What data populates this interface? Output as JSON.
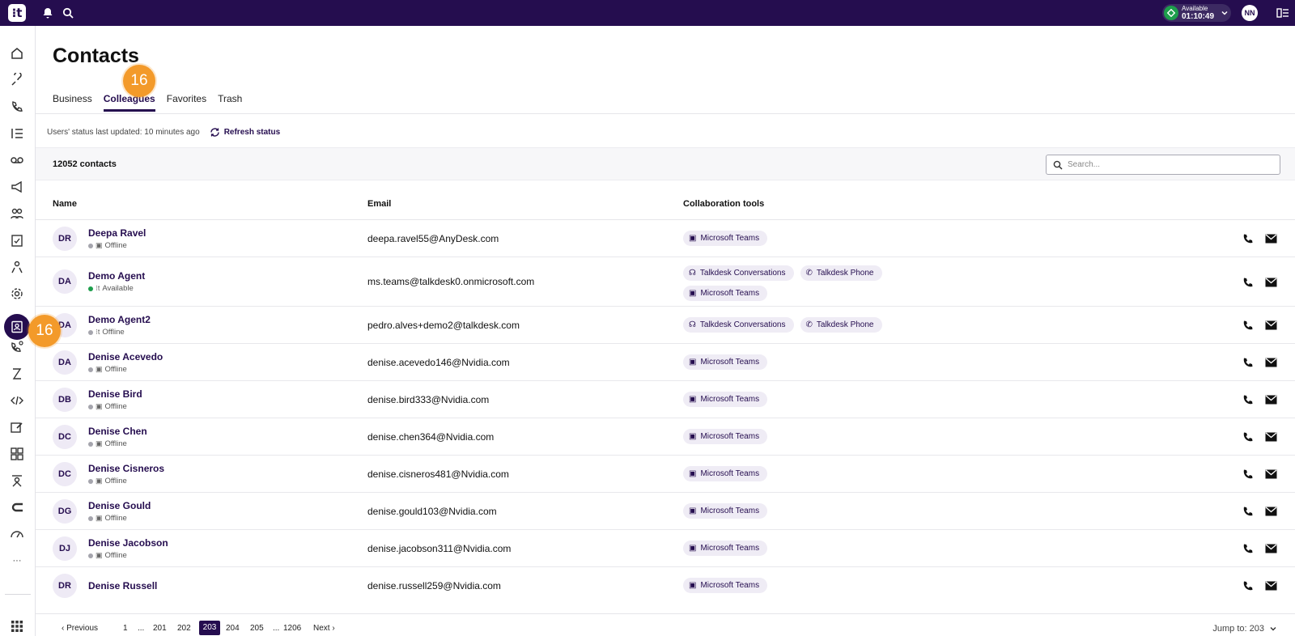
{
  "topbar": {
    "logo_glyph": "⁝t",
    "status_label": "Available",
    "status_timer": "01:10:49",
    "user_initials": "NN"
  },
  "badges": {
    "tab_badge": "16",
    "nav_badge": "16"
  },
  "page": {
    "title": "Contacts",
    "tabs": [
      "Business",
      "Colleagues",
      "Favorites",
      "Trash"
    ],
    "active_tab": "Colleagues"
  },
  "status_bar": {
    "last_updated": "Users' status last updated: 10 minutes ago",
    "refresh_label": "Refresh status"
  },
  "list": {
    "count": "12052 contacts",
    "search_placeholder": "Search..."
  },
  "table": {
    "headers": {
      "name": "Name",
      "email": "Email",
      "tools": "Collaboration tools"
    },
    "rows": [
      {
        "initials": "DR",
        "name": "Deepa Ravel",
        "status": "Offline",
        "email": "deepa.ravel55@AnyDesk.com"
      },
      {
        "initials": "DA",
        "name": "Demo Agent",
        "status": "Available",
        "email": "ms.teams@talkdesk0.onmicrosoft.com"
      },
      {
        "initials": "DA",
        "name": "Demo Agent2",
        "status": "Offline",
        "email": "pedro.alves+demo2@talkdesk.com"
      },
      {
        "initials": "DA",
        "name": "Denise Acevedo",
        "status": "Offline",
        "email": "denise.acevedo146@Nvidia.com"
      },
      {
        "initials": "DB",
        "name": "Denise Bird",
        "status": "Offline",
        "email": "denise.bird333@Nvidia.com"
      },
      {
        "initials": "DC",
        "name": "Denise Chen",
        "status": "Offline",
        "email": "denise.chen364@Nvidia.com"
      },
      {
        "initials": "DC",
        "name": "Denise Cisneros",
        "status": "Offline",
        "email": "denise.cisneros481@Nvidia.com"
      },
      {
        "initials": "DG",
        "name": "Denise Gould",
        "status": "Offline",
        "email": "denise.gould103@Nvidia.com"
      },
      {
        "initials": "DJ",
        "name": "Denise Jacobson",
        "status": "Offline",
        "email": "denise.jacobson311@Nvidia.com"
      },
      {
        "initials": "DR",
        "name": "Denise Russell",
        "status": "",
        "email": "denise.russell259@Nvidia.com"
      }
    ],
    "chips": {
      "teams": "Microsoft Teams",
      "conversations": "Talkdesk Conversations",
      "phone": "Talkdesk Phone"
    }
  },
  "pager": {
    "previous": "Previous",
    "next": "Next",
    "pages": [
      "1",
      "...",
      "201",
      "202",
      "203",
      "204",
      "205",
      "...",
      "1206"
    ],
    "current": "203",
    "jump_to": "Jump to: 203"
  },
  "colors": {
    "brand": "#250d4f",
    "accent": "#f39a2a",
    "available": "#1d9e4c"
  }
}
